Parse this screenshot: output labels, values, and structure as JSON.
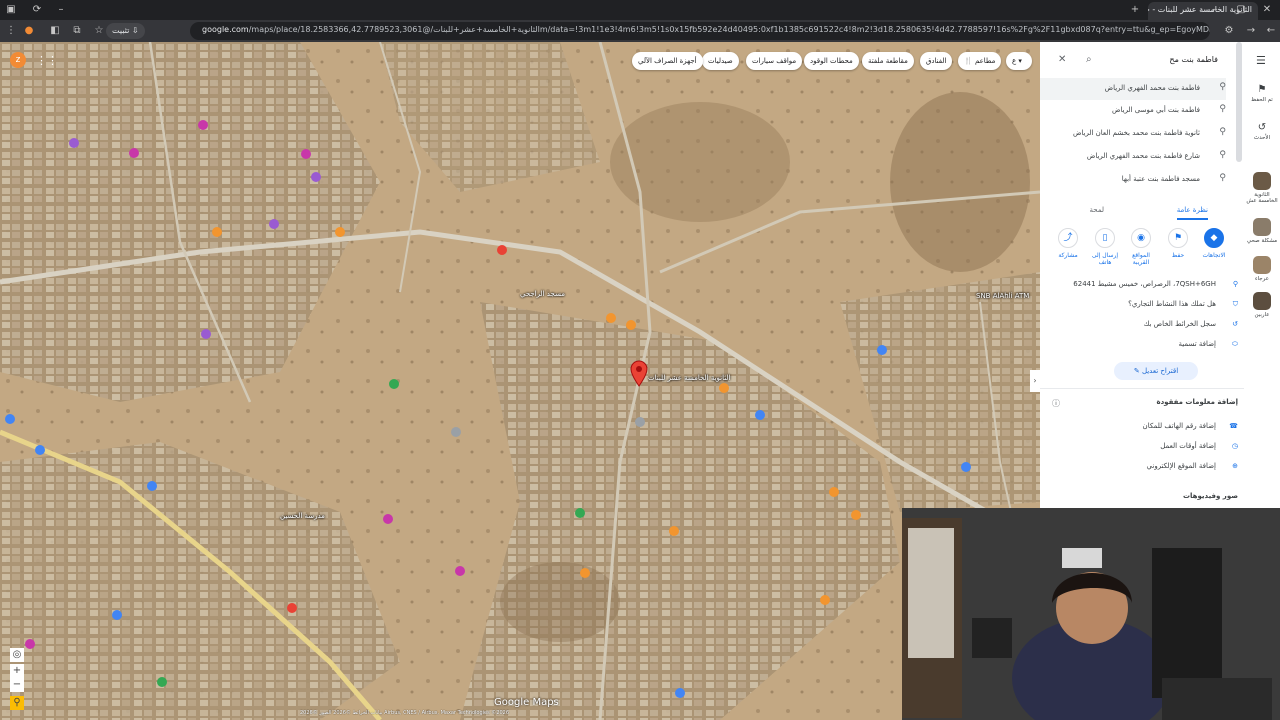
{
  "browser": {
    "tab_title": "الثانوية الخامسة عشر للبنات - خرائط",
    "install_label": "تثبيت",
    "url_host": "google.com",
    "url_rest": "/maps/place/الثانوية+الخامسة+عشر+للبنات/@18.2583366,42.7789523,3061m/data=!3m1!1e3!4m6!3m5!1s0x15fb592e24d40495:0xf1b1385c691522c4!8m2!3d18.2580635!4d42.7788597!16s%2Fg%2F11gbxd087q?entry=ttu&g_ep=EgoyMDI2MDIxMS4wIKXMDSoASAFQAw%3D%3D"
  },
  "map": {
    "chips": [
      "مطاعم",
      "الفنادق",
      "مقاطعة ملفتة",
      "محطات الوقود",
      "مواقف سيارات",
      "صيدليات",
      "أجهزة الصراف الآلي"
    ],
    "chip_letter": "ع",
    "brand": "Google Maps",
    "attribution": "بيانات الخرائط ©2026 الصور ©2026 Airbus, CNES / Airbus, Maxar Technologies ©2026",
    "place_labels": [
      "الثانوية الخامسة عشر للبنات",
      "SNB AlAhli ATM",
      "مسجد الراجحي",
      "مدرسة الحسين"
    ]
  },
  "panel": {
    "search_value": "فاطمة بنت مح",
    "suggestions": [
      "فاطمة بنت محمد الفهري الرياض",
      "فاطمة بنت أبي موسى الرياض",
      "ثانوية فاطمة بنت محمد بخشم العان الرياض",
      "شارع فاطمة بنت محمد الفهري الرياض",
      "مسجد فاطمة بنت عتبة أبها"
    ],
    "tabs": [
      "نظرة عامة",
      "لمحة"
    ],
    "actions": [
      "الاتجاهات",
      "حفظ",
      "المواقع القريبة",
      "إرسال إلى هاتف",
      "مشاركة"
    ],
    "address": "7QSH+6GH، الرصراص، خميس مشيط 62441",
    "claim": "هل تملك هذا النشاط التجاري؟",
    "history": "سجل الخرائط الخاص بك",
    "add_label": "إضافة تسمية",
    "suggest_edit": "اقتراح تعديل",
    "missing_info": "إضافة معلومات مفقودة",
    "add_phone": "إضافة رقم الهاتف للمكان",
    "add_hours": "إضافة أوقات العمل",
    "add_website": "إضافة الموقع الإلكتروني",
    "photos": "صور وفيديوهات"
  },
  "rail": {
    "items": [
      "تم الحفظ",
      "الأحدث",
      "الثانوية الخامسة عش",
      "مشكلة صحي",
      "عرجاء",
      "عاربين"
    ]
  },
  "colors": {
    "accent": "#1a73e8",
    "pin": "#ea4335",
    "satellite": "#b79d7b"
  }
}
